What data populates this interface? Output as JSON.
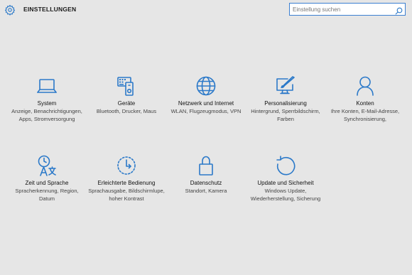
{
  "header": {
    "title": "EINSTELLUNGEN",
    "icon": "gear-icon"
  },
  "search": {
    "placeholder": "Einstellung suchen",
    "value": ""
  },
  "tiles": [
    {
      "title": "System",
      "desc": "Anzeige, Benachrichtigungen, Apps, Stromversorgung",
      "icon": "laptop-icon"
    },
    {
      "title": "Geräte",
      "desc": "Bluetooth, Drucker, Maus",
      "icon": "devices-icon"
    },
    {
      "title": "Netzwerk und Internet",
      "desc": "WLAN, Flugzeugmodus, VPN",
      "icon": "globe-icon"
    },
    {
      "title": "Personalisierung",
      "desc": "Hintergrund, Sperrbildschirm, Farben",
      "icon": "personalization-icon"
    },
    {
      "title": "Konten",
      "desc": "Ihre Konten, E-Mail-Adresse, Synchronisierung,",
      "icon": "person-icon"
    },
    {
      "title": "Zeit und Sprache",
      "desc": "Spracherkennung, Region, Datum",
      "icon": "time-language-icon"
    },
    {
      "title": "Erleichterte Bedienung",
      "desc": "Sprachausgabe, Bildschirmlupe, hoher Kontrast",
      "icon": "ease-of-access-icon"
    },
    {
      "title": "Datenschutz",
      "desc": "Standort, Kamera",
      "icon": "lock-icon"
    },
    {
      "title": "Update und Sicherheit",
      "desc": "Windows Update, Wiederherstellung, Sicherung",
      "icon": "update-icon"
    }
  ],
  "colors": {
    "accent": "#2b79c9",
    "background": "#e6e6e6"
  }
}
